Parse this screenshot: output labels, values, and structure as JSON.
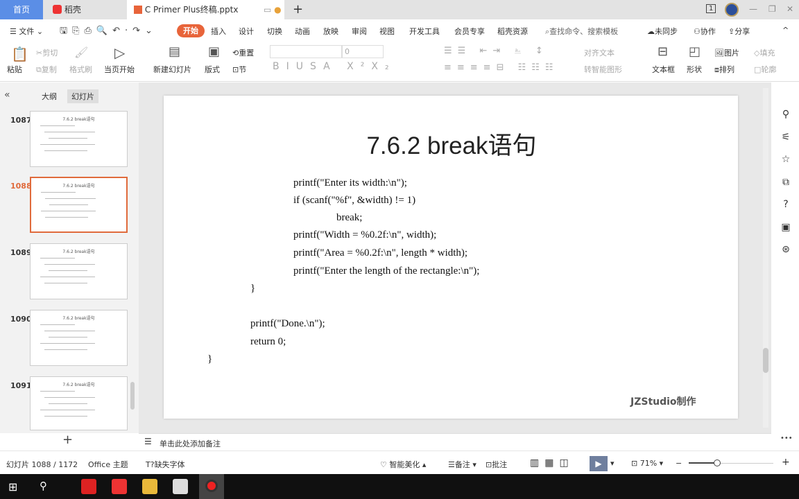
{
  "tabs": {
    "home": "首页",
    "daoke": "稻壳",
    "doc": "C Primer  Plus终稿.pptx",
    "new": "+"
  },
  "window": {
    "page_indicator": "1",
    "minimize": "—",
    "restore": "❐",
    "close": "✕"
  },
  "menu": {
    "file": "文件",
    "items": [
      "开始",
      "插入",
      "设计",
      "切换",
      "动画",
      "放映",
      "审阅",
      "视图",
      "开发工具",
      "会员专享",
      "稻壳资源"
    ],
    "active": "开始",
    "search_placeholder": "查找命令、搜索模板",
    "sync": "未同步",
    "collab": "协作",
    "share": "分享"
  },
  "ribbon": {
    "paste": "粘贴",
    "cut": "剪切",
    "copy": "复制",
    "format_painter": "格式刷",
    "play_from_current": "当页开始",
    "new_slide": "新建幻灯片",
    "layout": "版式",
    "section": "节",
    "reset": "重置",
    "font_size": "0",
    "align_text": "对齐文本",
    "smartart": "转智能图形",
    "textbox": "文本框",
    "shape": "形状",
    "picture": "图片",
    "arrange": "排列",
    "fill": "填充",
    "outline": "轮廓"
  },
  "left_panel": {
    "outline_tab": "大纲",
    "slides_tab": "幻灯片",
    "active_tab": "幻灯片",
    "thumbs": [
      {
        "num": "1087",
        "title": "7.6.2 break语句"
      },
      {
        "num": "1088",
        "title": "7.6.2 break语句",
        "selected": true
      },
      {
        "num": "1089",
        "title": "7.6.2 break语句"
      },
      {
        "num": "1090",
        "title": "7.6.2 break语句"
      },
      {
        "num": "1091",
        "title": "7.6.2 break语句"
      }
    ],
    "add": "+"
  },
  "slide": {
    "title": "7.6.2 break语句",
    "code": [
      "printf(\"Enter its width:\\n\");",
      "if (scanf(\"%f\", &width) != 1)",
      "break;",
      "printf(\"Width = %0.2f:\\n\", width);",
      "printf(\"Area = %0.2f:\\n\", length * width);",
      "printf(\"Enter the length of the rectangle:\\n\");",
      "}",
      "printf(\"Done.\\n\");",
      "return 0;",
      "}"
    ],
    "watermark": "JZStudio制作"
  },
  "notes": {
    "placeholder": "单击此处添加备注",
    "more": "•••"
  },
  "status": {
    "slide_counter": "幻灯片 1088 / 1172",
    "theme": "Office 主题",
    "missing_font": "缺失字体",
    "beautify": "智能美化",
    "notes": "备注",
    "comments": "批注",
    "zoom": "71%",
    "zoom_level": 71
  },
  "colors": {
    "accent": "#e8643a",
    "home_tab": "#5b8ee6",
    "selected_thumb": "#e06a3b"
  }
}
